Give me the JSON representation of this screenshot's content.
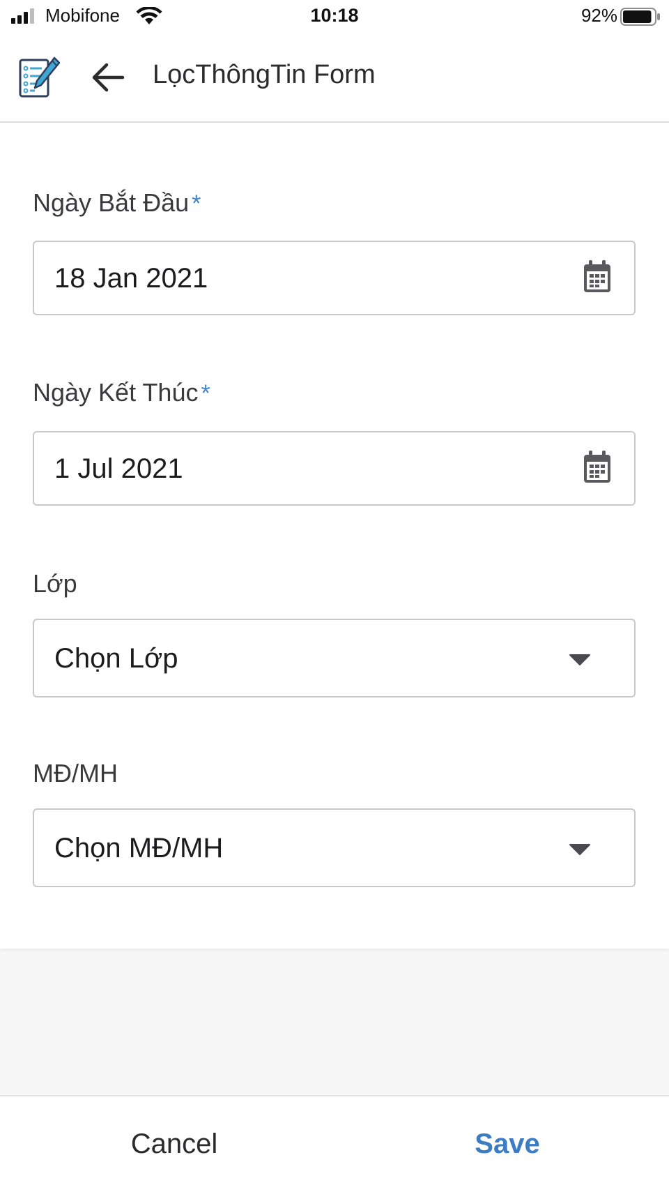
{
  "status_bar": {
    "carrier": "Mobifone",
    "time": "10:18",
    "battery_percent": "92%",
    "battery_level": 0.92,
    "signal_icon": "cellular-signal-icon",
    "wifi_icon": "wifi-icon",
    "battery_icon": "battery-icon"
  },
  "header": {
    "app_icon": "form-checklist-icon",
    "back_icon": "arrow-left-icon",
    "title": "LọcThôngTin Form"
  },
  "form": {
    "start_date": {
      "label": "Ngày Bắt Đầu",
      "required_mark": "*",
      "value": "18 Jan 2021",
      "icon": "calendar-icon"
    },
    "end_date": {
      "label": "Ngày Kết Thúc",
      "required_mark": "*",
      "value": "1 Jul 2021",
      "icon": "calendar-icon"
    },
    "class_select": {
      "label": "Lớp",
      "value": "Chọn Lớp",
      "icon": "caret-down-icon"
    },
    "subject_select": {
      "label": "MĐ/MH",
      "value": "Chọn MĐ/MH",
      "icon": "caret-down-icon"
    }
  },
  "actions": {
    "cancel_label": "Cancel",
    "save_label": "Save"
  },
  "colors": {
    "accent": "#3b7cc2",
    "required": "#3f84c5",
    "border": "#c9c9cc",
    "background": "#f7f7f8"
  }
}
